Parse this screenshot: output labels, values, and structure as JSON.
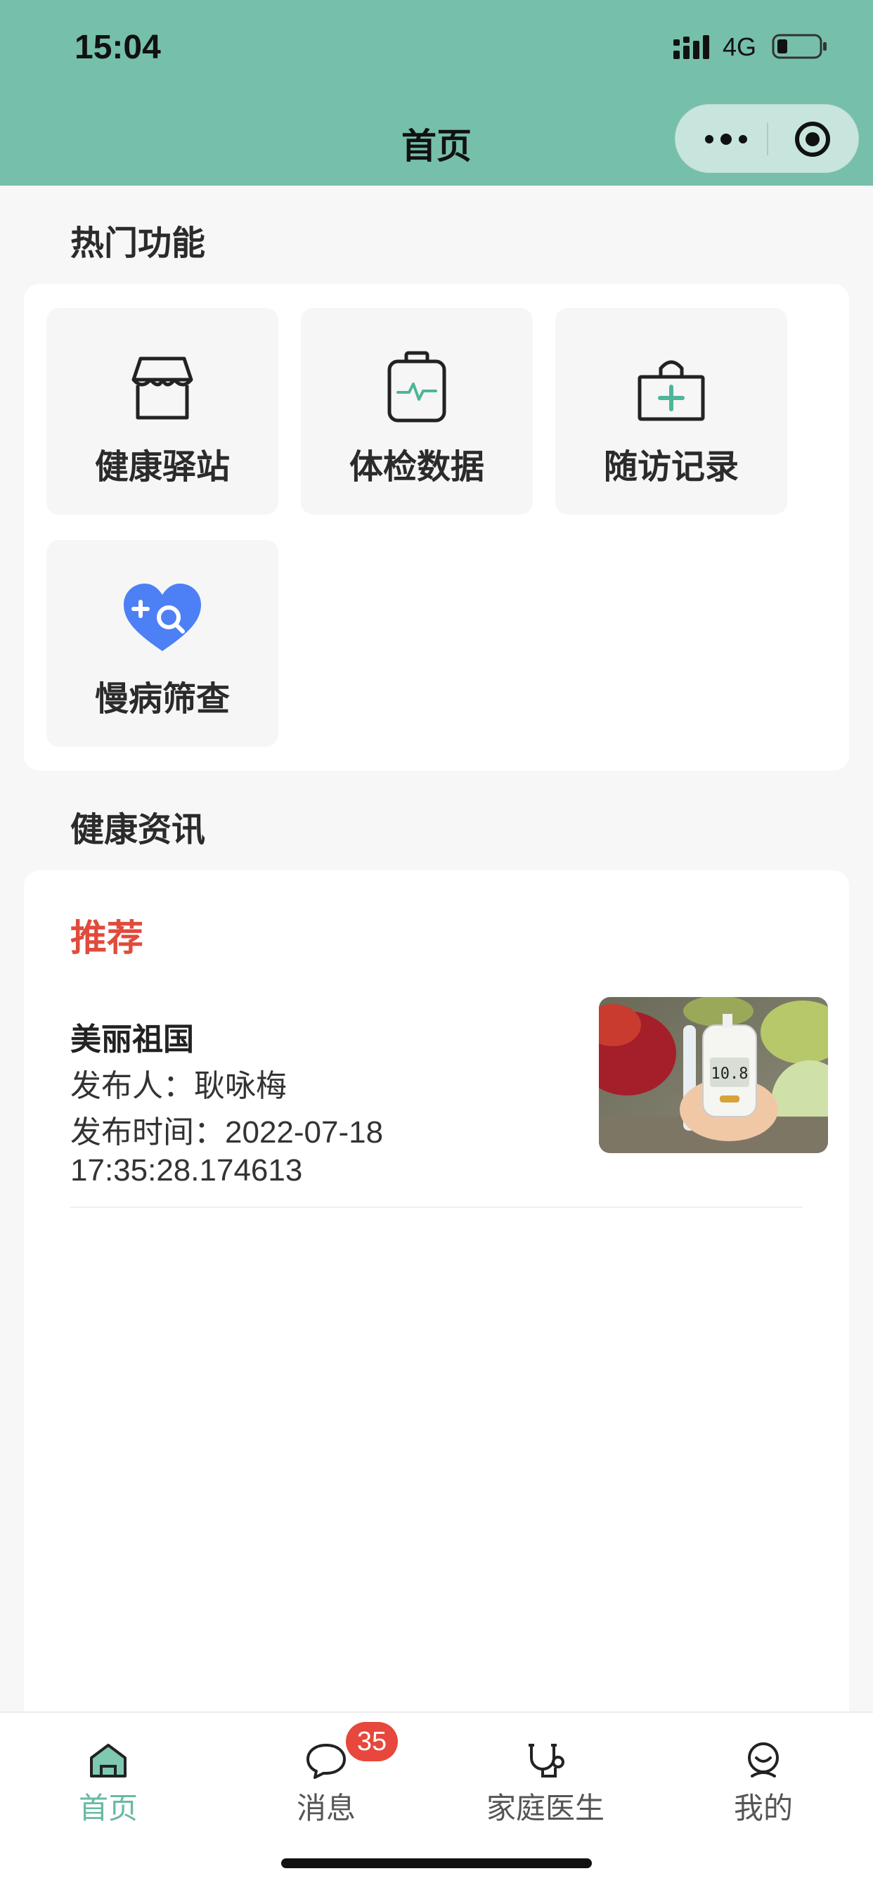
{
  "status_bar": {
    "time": "15:04",
    "network": "4G"
  },
  "nav": {
    "title": "首页"
  },
  "hot": {
    "title": "热门功能",
    "items": [
      {
        "label": "健康驿站",
        "icon": "store-icon"
      },
      {
        "label": "体检数据",
        "icon": "medical-kit-icon"
      },
      {
        "label": "随访记录",
        "icon": "first-aid-bag-icon"
      },
      {
        "label": "慢病筛查",
        "icon": "heart-search-icon"
      }
    ]
  },
  "news": {
    "title": "健康资讯",
    "tab": "推荐",
    "items": [
      {
        "title": "美丽祖国",
        "publisher": "发布人：耿咏梅",
        "date": "发布时间：2022-07-18",
        "time": "17:35:28.174613",
        "thumb_text": "10.8"
      }
    ]
  },
  "tabbar": {
    "items": [
      {
        "label": "首页",
        "icon": "home-icon",
        "active": true
      },
      {
        "label": "消息",
        "icon": "chat-bubble-icon",
        "badge": "35"
      },
      {
        "label": "家庭医生",
        "icon": "doctor-stethoscope-icon"
      },
      {
        "label": "我的",
        "icon": "user-face-icon"
      }
    ]
  },
  "colors": {
    "brand": "#76bfab",
    "active_tab": "#69b9a3",
    "recommend": "#e04b3c",
    "badge": "#e7473c",
    "heart_icon": "#4d80f5"
  }
}
